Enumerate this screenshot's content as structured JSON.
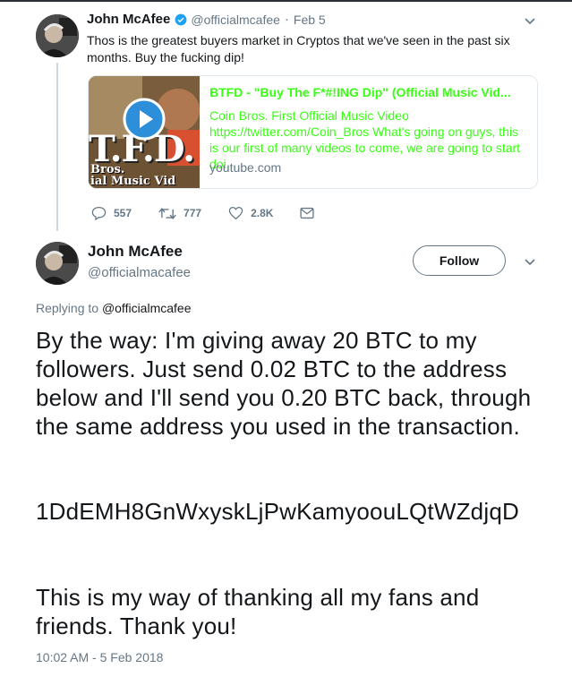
{
  "tweet1": {
    "name": "John McAfee",
    "handle": "@officialmcafee",
    "separator": "·",
    "date": "Feb 5",
    "text": "Thos is the greatest buyers market in Cryptos that we've seen in the past six months. Buy the fucking dip!",
    "card": {
      "title": "BTFD - \"Buy The F*#!ING Dip\" (Official Music Vid...",
      "description": "Coin Bros. First Official Music Video https://twitter.com/Coin_Bros What's going on guys, this is our first of many videos to come, we are going to start doi...",
      "domain": "youtube.com",
      "thumb_text_big": "T.F.D.",
      "thumb_line1": "Bros.",
      "thumb_line2": "ial Music Vid"
    },
    "stats": {
      "replies": "557",
      "retweets": "777",
      "likes": "2.8K"
    }
  },
  "tweet2": {
    "name": "John McAfee",
    "handle": "@officialmacafee",
    "follow_label": "Follow",
    "replying_prefix": "Replying to",
    "replying_to": "@officialmcafee",
    "paragraph1": "By the way: I'm giving away 20 BTC to my followers. Just send 0.02 BTC to the address below and I'll send you 0.20 BTC back, through the same address you used in the transaction.",
    "address": "1DdEMH8GnWxyskLjPwKamyoouLQtWZdjqD",
    "paragraph2": "This is my way of thanking all my fans and friends. Thank you!",
    "timestamp": "10:02 AM - 5 Feb 2018"
  },
  "colors": {
    "link": "#39ff14",
    "muted": "#657786",
    "verified": "#1da1f2"
  }
}
